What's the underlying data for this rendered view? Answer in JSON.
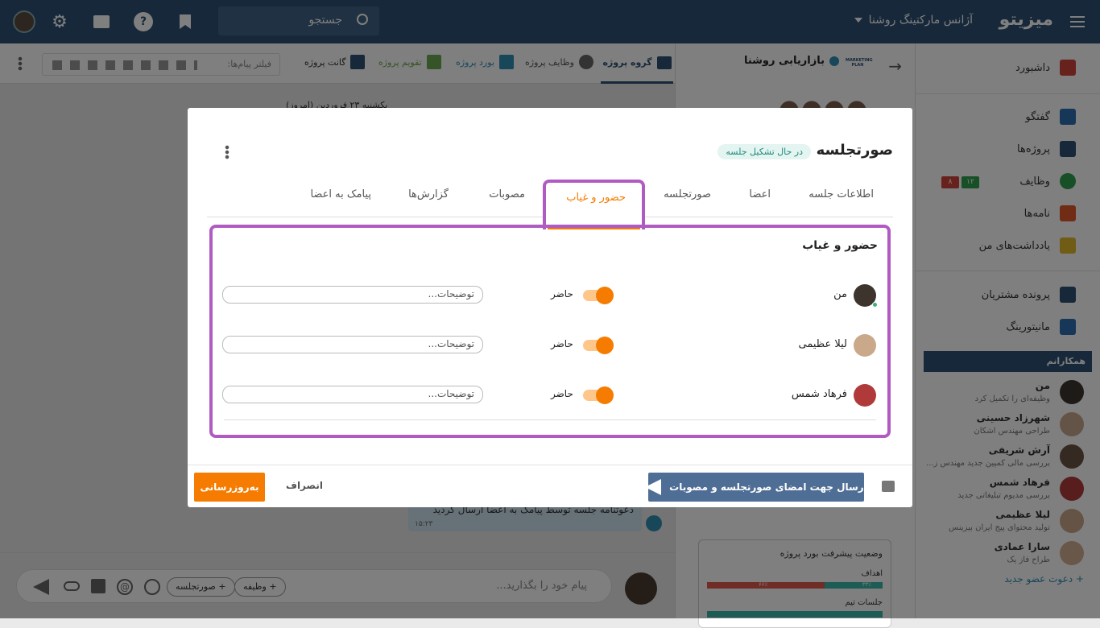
{
  "topbar": {
    "brand": "میزیتو",
    "org": "آژانس مارکتینگ روشنا",
    "search_placeholder": "جستجو"
  },
  "sidebar": {
    "items": [
      {
        "label": "داشبورد",
        "icon": "home-icon",
        "color": "#d0453a"
      },
      {
        "label": "گفتگو",
        "icon": "chat-icon",
        "color": "#2e6fb3"
      },
      {
        "label": "پروژه‌ها",
        "icon": "projects-icon",
        "color": "#2c5073"
      },
      {
        "label": "وظایف",
        "icon": "tasks-icon",
        "color": "#2e9e4f"
      },
      {
        "label": "نامه‌ها",
        "icon": "inbox-icon",
        "color": "#e0592a"
      },
      {
        "label": "یادداشت‌های من",
        "icon": "notes-icon",
        "color": "#e2b92a"
      },
      {
        "label": "پرونده مشتریان",
        "icon": "contact-icon",
        "color": "#2c5073"
      },
      {
        "label": "مانیتورینگ",
        "icon": "monitoring-icon",
        "color": "#2e6fb3"
      }
    ],
    "tasks_badges": [
      "۱۲",
      "۸"
    ],
    "colleagues_header": "همکارانم",
    "colleagues": [
      {
        "name": "من",
        "desc": "وظیفه‌ای را تکمیل کرد"
      },
      {
        "name": "شهرزاد حسینی",
        "desc": "طراحی مهندس اشکان"
      },
      {
        "name": "آرش شریفی",
        "desc": "بررسی مالی کمپین جدید مهندس ز..."
      },
      {
        "name": "فرهاد شمس",
        "desc": "بررسی مدیوم تبلیغاتی جدید"
      },
      {
        "name": "لیلا عظیمی",
        "desc": "تولید محتوای پیج ایران بیزینس"
      },
      {
        "name": "سارا عمادی",
        "desc": "طراح فاز یک"
      }
    ],
    "invite": "+ دعوت عضو جدید"
  },
  "project": {
    "title": "بازاریابی روشنا",
    "logo_text": "MARKETING PLAN",
    "board_title": "وضعیت پیشرفت بورد پروژه",
    "goal_label": "اهداف",
    "goal_done": "۳۳٪",
    "goal_todo": "۶۶٪",
    "meetings_label": "جلسات تیم"
  },
  "chat_tabs": [
    {
      "label": "گروه پروژه",
      "active": true
    },
    {
      "label": "وظایف پروژه"
    },
    {
      "label": "بورد پروژه"
    },
    {
      "label": "تقویم پروژه"
    },
    {
      "label": "گانت پروژه"
    }
  ],
  "chat": {
    "filter_placeholder": "فیلتر پیام‌ها:",
    "date_text": "یکشنبه ۲۳ فروردین (امروز)",
    "message": "دعوتنامه جلسه توسط پیامک به اعضا ارسال گردید",
    "message_time": "۱۵:۲۳",
    "input_placeholder": "پیام خود را بگذارید...",
    "chip_task": "+ وظیفه",
    "chip_minutes": "+ صورتجلسه"
  },
  "modal": {
    "title": "صورتجلسه",
    "status": "در حال تشکیل جلسه",
    "tabs": [
      "اطلاعات جلسه",
      "اعضا",
      "صورتجلسه",
      "حضور و غیاب",
      "مصوبات",
      "گزارش‌ها",
      "پیامک به اعضا"
    ],
    "active_tab": 3,
    "section_title": "حضور و غیاب",
    "attendees": [
      {
        "name": "من",
        "status": "حاضر",
        "present": true,
        "note_placeholder": "توضیحات..."
      },
      {
        "name": "لیلا عظیمی",
        "status": "حاضر",
        "present": true,
        "note_placeholder": "توضیحات..."
      },
      {
        "name": "فرهاد شمس",
        "status": "حاضر",
        "present": true,
        "note_placeholder": "توضیحات..."
      }
    ],
    "send_button": "ارسال جهت امضای صورتجلسه و مصوبات",
    "cancel_button": "انصراف",
    "update_button": "به‌روزرسانی"
  },
  "colors": {
    "topbar": "#2c5073",
    "accent_orange": "#f57c00",
    "highlight_purple": "#b05bc2",
    "send_button": "#4f6e95",
    "status_chip": "#e3f4f1"
  }
}
